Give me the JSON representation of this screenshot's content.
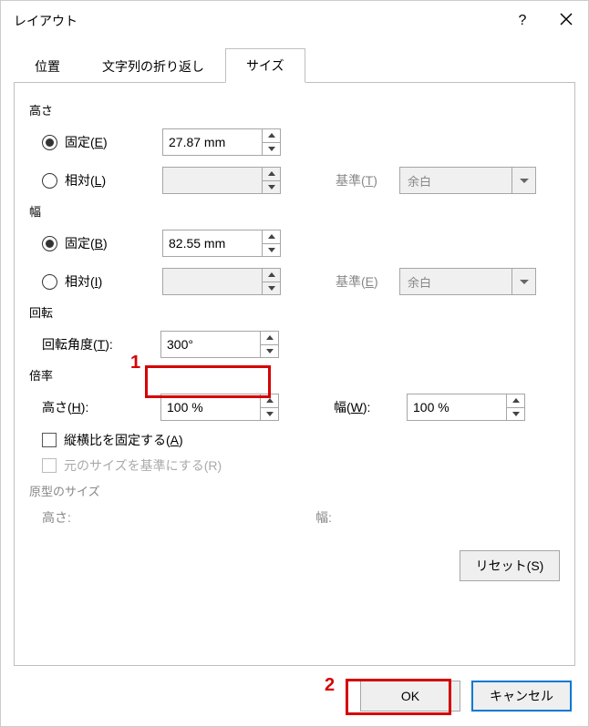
{
  "title": "レイアウト",
  "help": "?",
  "tabs": [
    "位置",
    "文字列の折り返し",
    "サイズ"
  ],
  "active_tab": 2,
  "height": {
    "label": "高さ",
    "fixed_label": "固定(E)",
    "fixed_value": "27.87 mm",
    "relative_label": "相対(L)",
    "relative_value": "",
    "basis_label": "基準(T)",
    "basis_value": "余白"
  },
  "width": {
    "label": "幅",
    "fixed_label": "固定(B)",
    "fixed_value": "82.55 mm",
    "relative_label": "相対(I)",
    "relative_value": "",
    "basis_label": "基準(E)",
    "basis_value": "余白"
  },
  "rotate": {
    "label": "回転",
    "angle_label": "回転角度(T):",
    "angle_value": "300°"
  },
  "scale": {
    "label": "倍率",
    "h_label": "高さ(H):",
    "h_value": "100 %",
    "w_label": "幅(W):",
    "w_value": "100 %",
    "lock_label": "縦横比を固定する(A)",
    "orig_label": "元のサイズを基準にする(R)"
  },
  "orig": {
    "label": "原型のサイズ",
    "h_label": "高さ:",
    "w_label": "幅:"
  },
  "reset_label": "リセット(S)",
  "ok_label": "OK",
  "cancel_label": "キャンセル",
  "anno": {
    "1": "1",
    "2": "2"
  }
}
